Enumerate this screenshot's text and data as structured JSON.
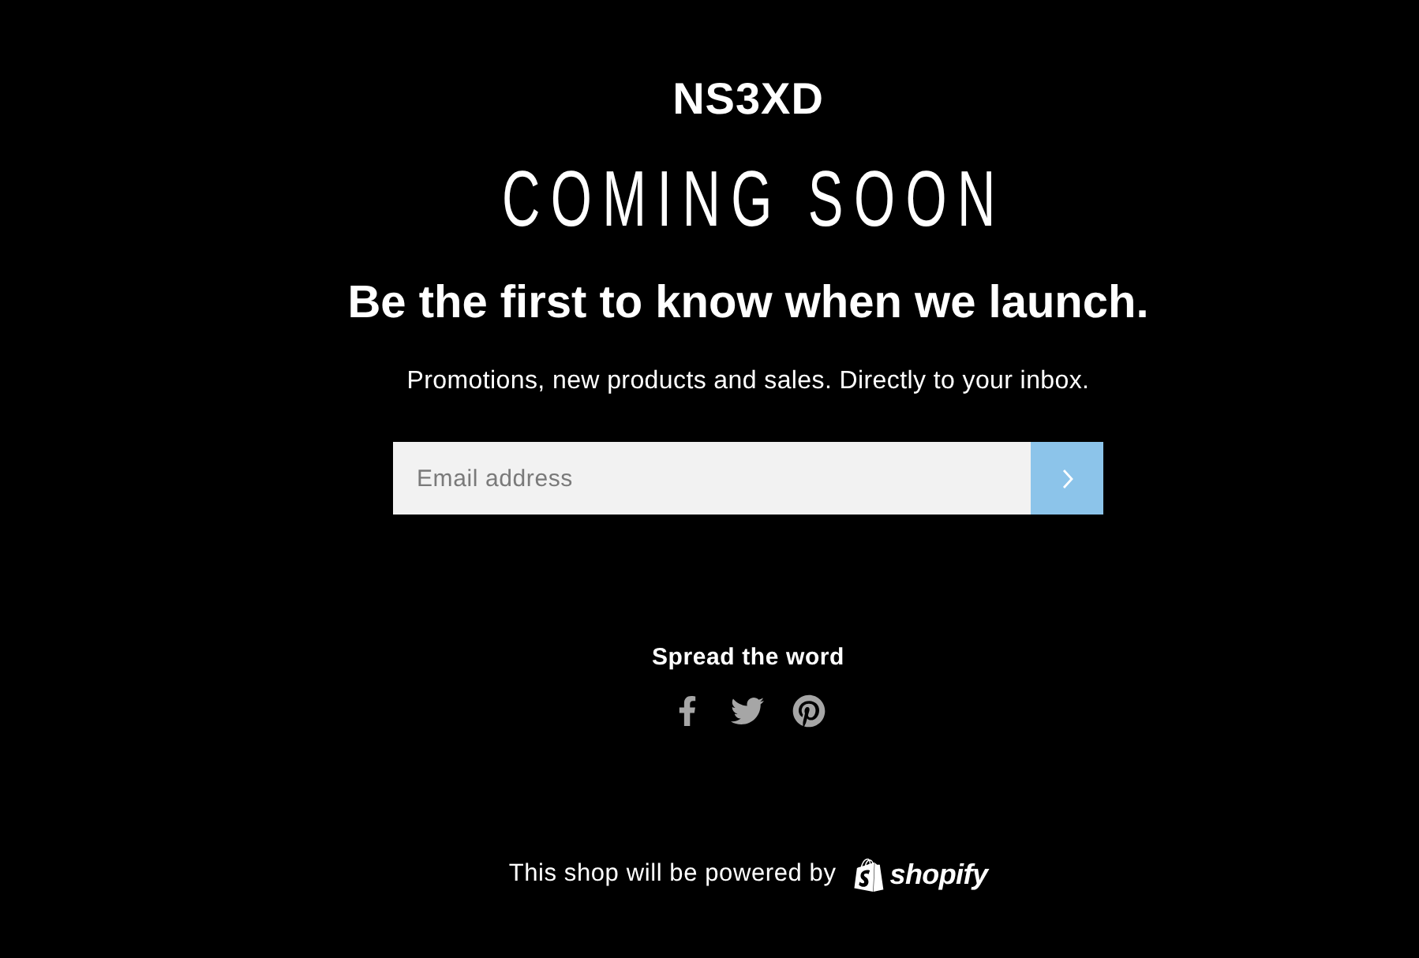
{
  "brand": {
    "name": "NS3XD"
  },
  "hero": {
    "title": "COMING SOON",
    "headline": "Be the first to know when we launch.",
    "subtitle": "Promotions, new products and sales. Directly to your inbox."
  },
  "signup": {
    "email": {
      "placeholder": "Email address"
    }
  },
  "share": {
    "heading": "Spread the word"
  },
  "footer": {
    "text": "This shop will be powered by",
    "logo": "shopify"
  }
}
